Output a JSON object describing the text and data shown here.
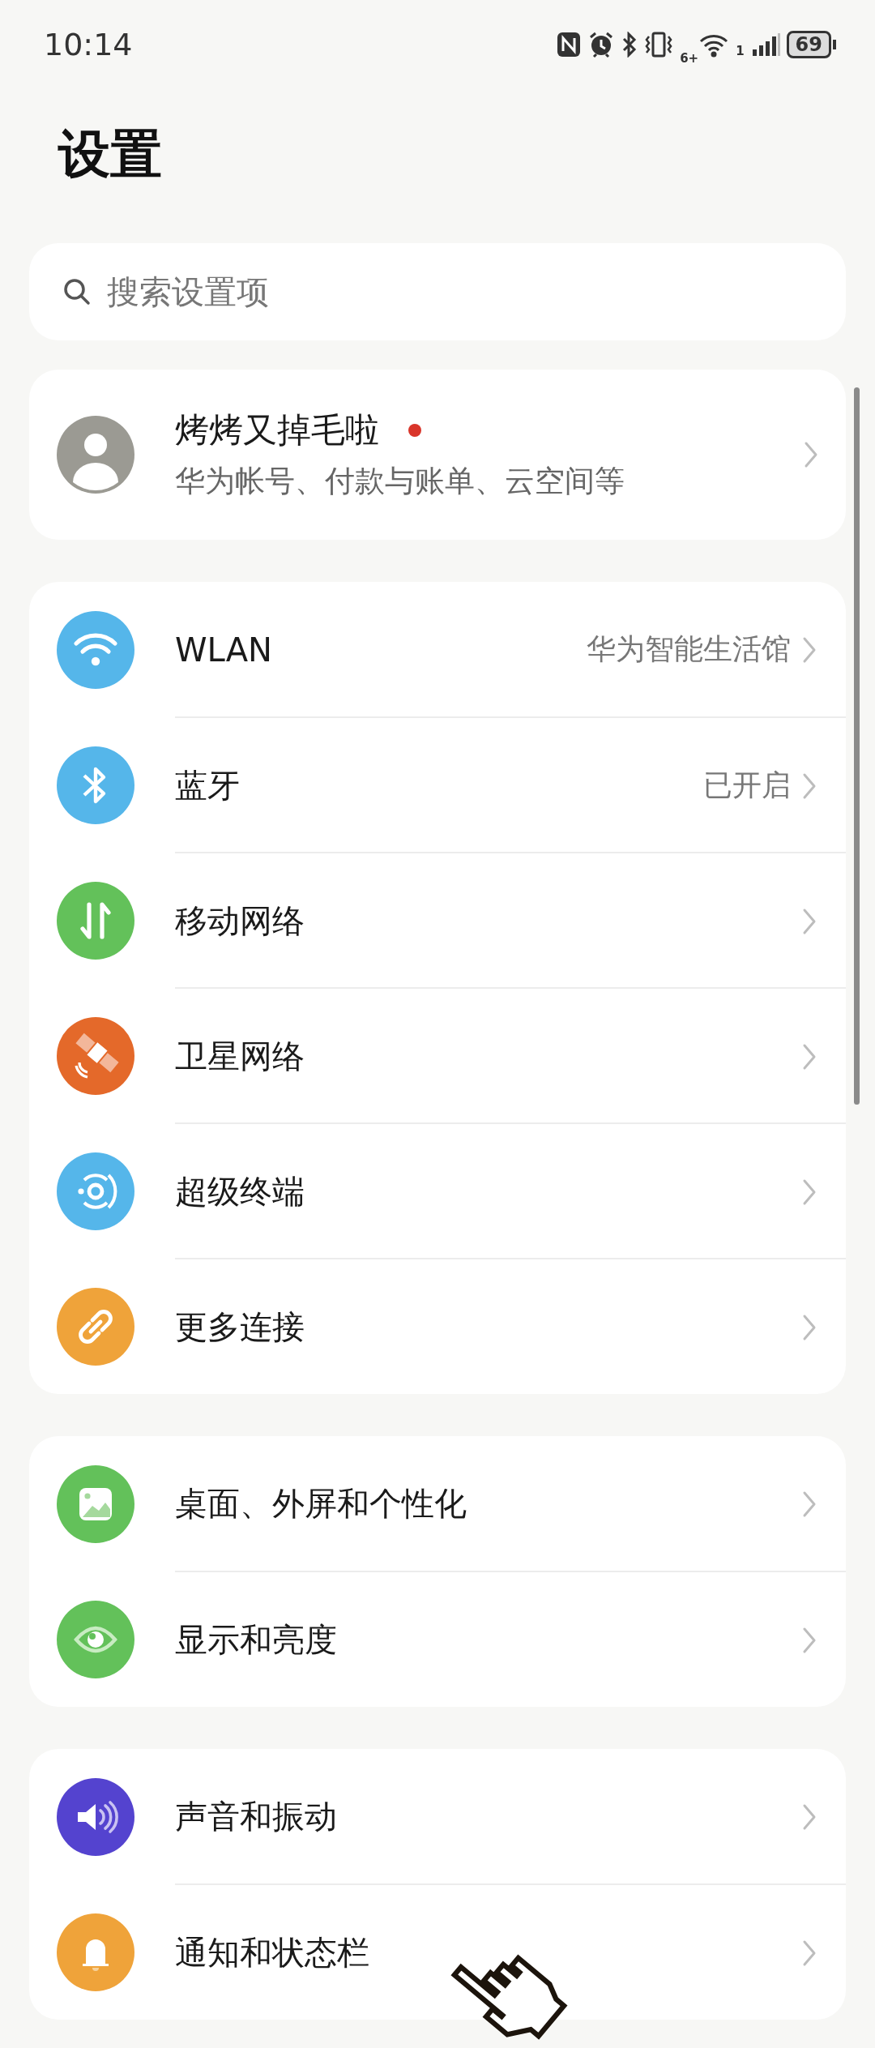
{
  "status_bar": {
    "time": "10:14",
    "network_type": "6+",
    "sim": "1",
    "battery": "69"
  },
  "title": "设置",
  "search": {
    "placeholder": "搜索设置项"
  },
  "profile": {
    "name": "烤烤又掉毛啦",
    "subtitle": "华为帐号、付款与账单、云空间等",
    "notification_dot": true
  },
  "groups": [
    {
      "items": [
        {
          "kind": "wifi",
          "color": "#55b6ea",
          "label": "WLAN",
          "value": "华为智能生活馆"
        },
        {
          "kind": "bluetooth",
          "color": "#55b6ea",
          "label": "蓝牙",
          "value": "已开启"
        },
        {
          "kind": "mobile",
          "color": "#63c15a",
          "label": "移动网络"
        },
        {
          "kind": "satellite",
          "color": "#e4692a",
          "label": "卫星网络"
        },
        {
          "kind": "terminal",
          "color": "#55b6ea",
          "label": "超级终端"
        },
        {
          "kind": "link",
          "color": "#efa33a",
          "label": "更多连接"
        }
      ]
    },
    {
      "items": [
        {
          "kind": "wallpaper",
          "color": "#63c15a",
          "label": "桌面、外屏和个性化"
        },
        {
          "kind": "eye",
          "color": "#63c15a",
          "label": "显示和亮度"
        }
      ]
    },
    {
      "items": [
        {
          "kind": "sound",
          "color": "#5443cf",
          "label": "声音和振动"
        },
        {
          "kind": "bell",
          "color": "#efa33a",
          "label": "通知和状态栏"
        }
      ]
    }
  ]
}
